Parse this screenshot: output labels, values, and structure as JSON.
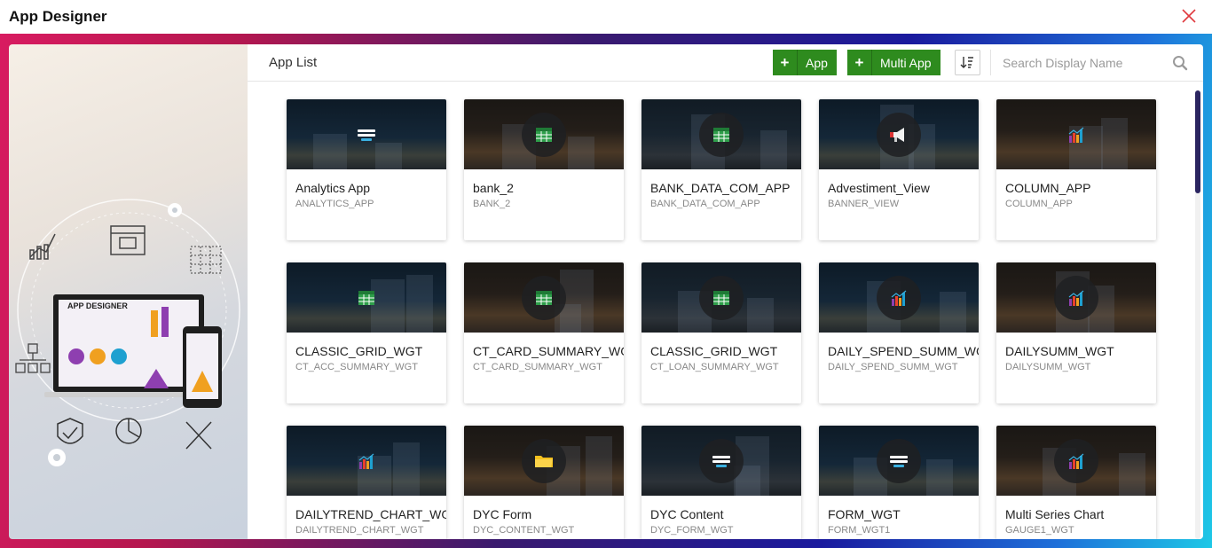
{
  "window": {
    "title": "App Designer",
    "close_icon": "close-x-icon"
  },
  "illustration": {
    "laptop_heading": "APP DESIGNER"
  },
  "toolbar": {
    "page_title": "App List",
    "add_app_label": "App",
    "add_multi_app_label": "Multi App",
    "search_placeholder": "Search Display Name",
    "accent": "#2e8b1e"
  },
  "cards": [
    {
      "name": "Analytics App",
      "code": "ANALYTICS_APP",
      "icon": "form-icon"
    },
    {
      "name": "bank_2",
      "code": "BANK_2",
      "icon": "grid-icon"
    },
    {
      "name": "BANK_DATA_COM_APP",
      "code": "BANK_DATA_COM_APP",
      "icon": "grid-icon"
    },
    {
      "name": "Advestiment_View",
      "code": "BANNER_VIEW",
      "icon": "megaphone-icon"
    },
    {
      "name": "COLUMN_APP",
      "code": "COLUMN_APP",
      "icon": "chart-icon"
    },
    {
      "name": "CLASSIC_GRID_WGT",
      "code": "CT_ACC_SUMMARY_WGT",
      "icon": "grid-icon"
    },
    {
      "name": "CT_CARD_SUMMARY_WGT",
      "code": "CT_CARD_SUMMARY_WGT",
      "icon": "grid-icon"
    },
    {
      "name": "CLASSIC_GRID_WGT",
      "code": "CT_LOAN_SUMMARY_WGT",
      "icon": "grid-icon"
    },
    {
      "name": "DAILY_SPEND_SUMM_WGT",
      "code": "DAILY_SPEND_SUMM_WGT",
      "icon": "chart-icon"
    },
    {
      "name": "DAILYSUMM_WGT",
      "code": "DAILYSUMM_WGT",
      "icon": "chart-icon"
    },
    {
      "name": "DAILYTREND_CHART_WGT",
      "code": "DAILYTREND_CHART_WGT",
      "icon": "chart-icon"
    },
    {
      "name": "DYC Form",
      "code": "DYC_CONTENT_WGT",
      "icon": "folder-icon"
    },
    {
      "name": "DYC Content",
      "code": "DYC_FORM_WGT",
      "icon": "form-icon"
    },
    {
      "name": "FORM_WGT",
      "code": "FORM_WGT1",
      "icon": "form-icon"
    },
    {
      "name": "Multi Series Chart",
      "code": "GAUGE1_WGT",
      "icon": "chart-icon"
    }
  ]
}
